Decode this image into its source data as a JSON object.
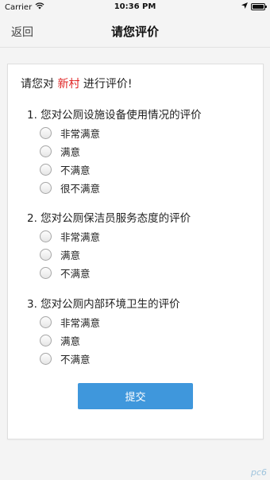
{
  "status_bar": {
    "carrier": "Carrier",
    "time": "10:36 PM",
    "battery_level": 1.0
  },
  "nav": {
    "back_label": "返回",
    "title": "请您评价"
  },
  "survey": {
    "intro_prefix": "请您对",
    "intro_highlight": "新村",
    "intro_suffix": "进行评价!",
    "highlight_color": "#e02424",
    "questions": [
      {
        "title": "1. 您对公厕设施设备使用情况的评价",
        "options": [
          "非常满意",
          "满意",
          "不满意",
          "很不满意"
        ]
      },
      {
        "title": "2. 您对公厕保洁员服务态度的评价",
        "options": [
          "非常满意",
          "满意",
          "不满意"
        ]
      },
      {
        "title": "3. 您对公厕内部环境卫生的评价",
        "options": [
          "非常满意",
          "满意",
          "不满意"
        ]
      }
    ],
    "submit_label": "提交",
    "submit_color": "#3f97dc"
  },
  "watermark": "pc6"
}
